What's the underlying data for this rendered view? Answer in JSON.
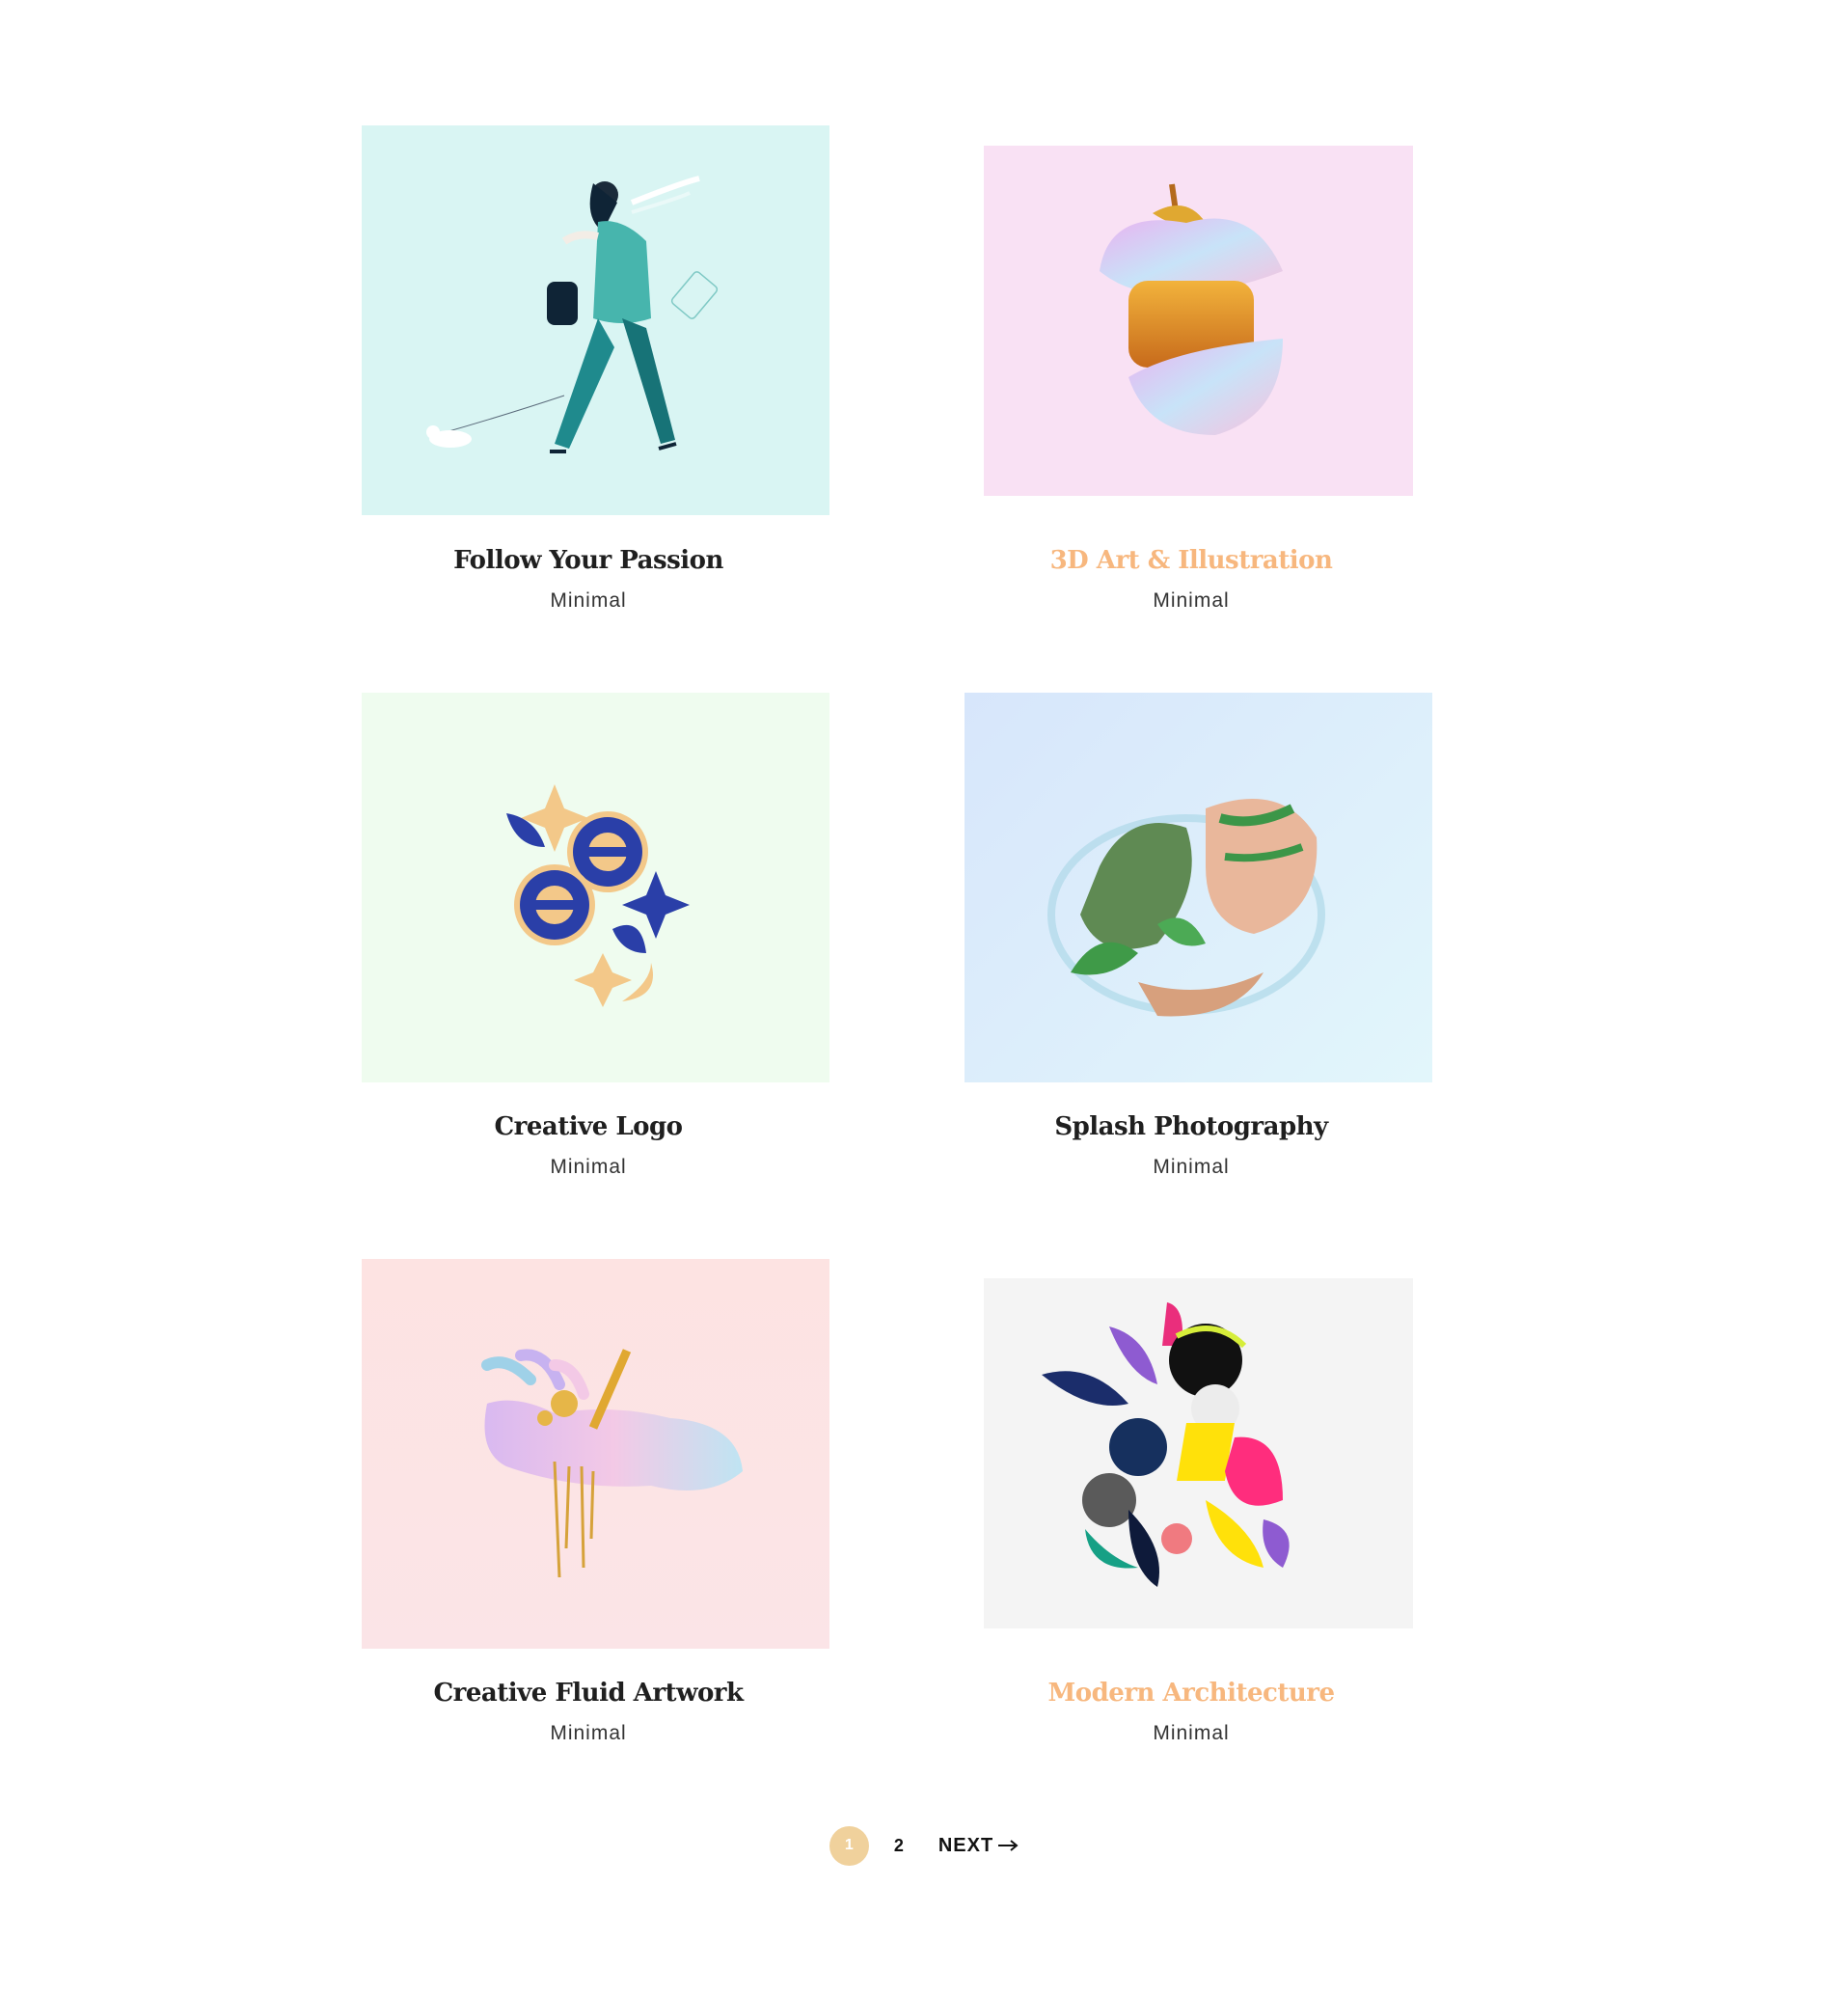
{
  "accent_color": "#f7b77e",
  "pagination_color": "#f0d19c",
  "items": [
    {
      "title": "Follow Your Passion",
      "category": "Minimal",
      "bg": "#d9f5f3",
      "highlight": false
    },
    {
      "title": "3D Art & Illustration",
      "category": "Minimal",
      "bg": "#f9e1f4",
      "highlight": true
    },
    {
      "title": "Creative Logo",
      "category": "Minimal",
      "bg": "#effcef",
      "highlight": false
    },
    {
      "title": "Splash Photography",
      "category": "Minimal",
      "bg": "#dff0fa",
      "highlight": false
    },
    {
      "title": "Creative Fluid Artwork",
      "category": "Minimal",
      "bg": "#fde6e3",
      "highlight": false
    },
    {
      "title": "Modern Architecture",
      "category": "Minimal",
      "bg": "#f4f4f4",
      "highlight": true
    }
  ],
  "pagination": {
    "current": "1",
    "page2": "2",
    "next_label": "NEXT",
    "next_icon": "arrow-right-icon"
  }
}
